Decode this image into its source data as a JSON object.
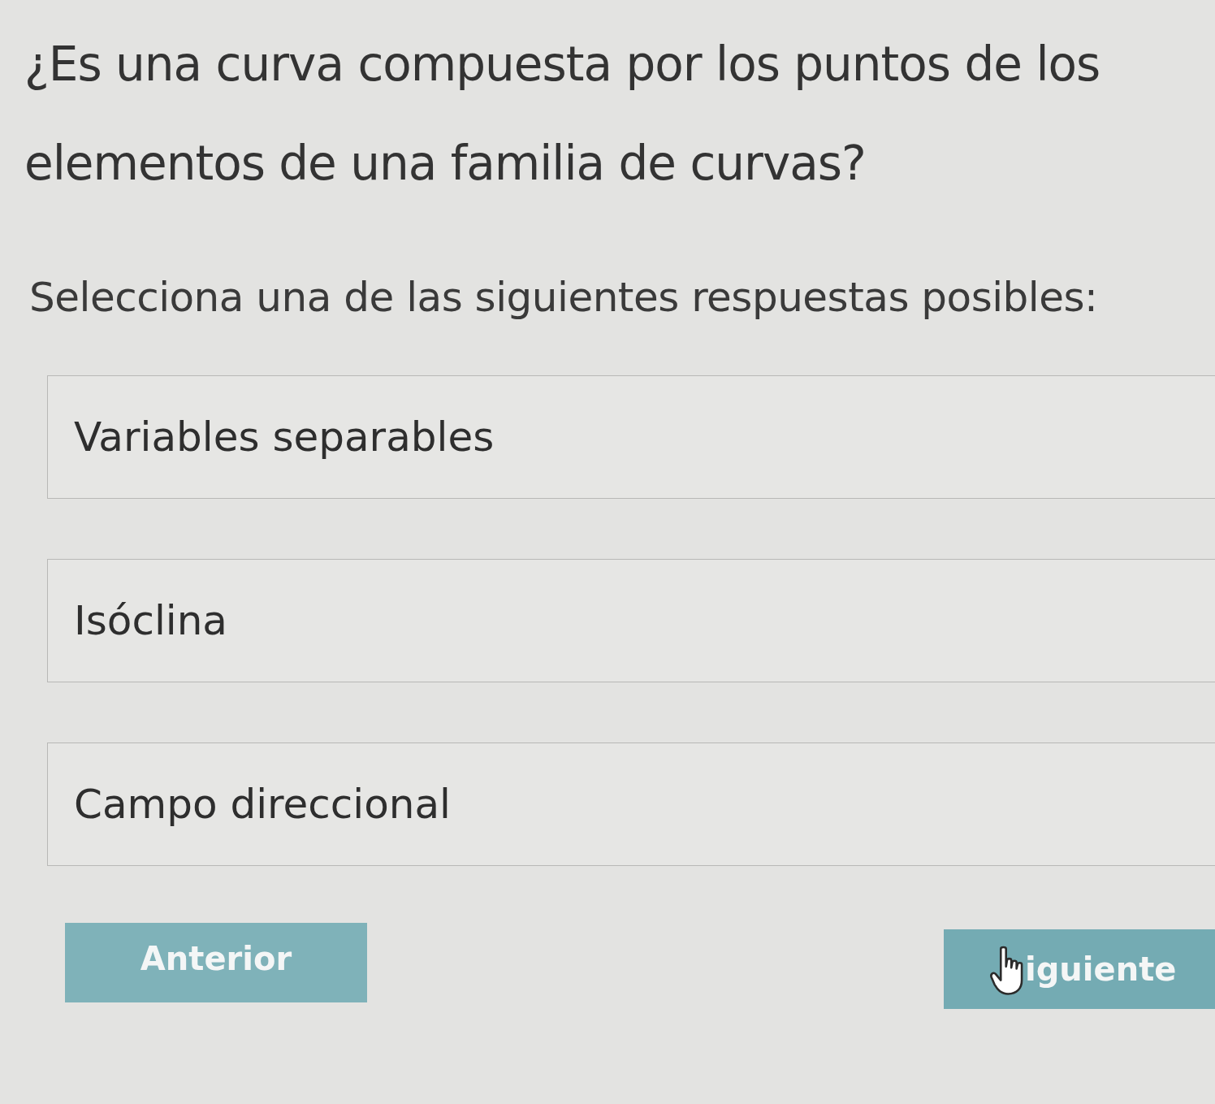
{
  "question": "¿Es una curva compuesta por los puntos de los elementos de una familia de curvas?",
  "instruction": "Selecciona una de las siguientes respuestas posibles:",
  "options": [
    {
      "label": "Variables separables",
      "selected": false
    },
    {
      "label": "Isóclina",
      "selected": false
    },
    {
      "label": "Campo direccional",
      "selected": false
    }
  ],
  "buttons": [
    {
      "kind": "previous",
      "label": "Anterior",
      "cursor_over": false
    },
    {
      "kind": "next",
      "label": "iguiente",
      "cursor_over": true
    }
  ]
}
